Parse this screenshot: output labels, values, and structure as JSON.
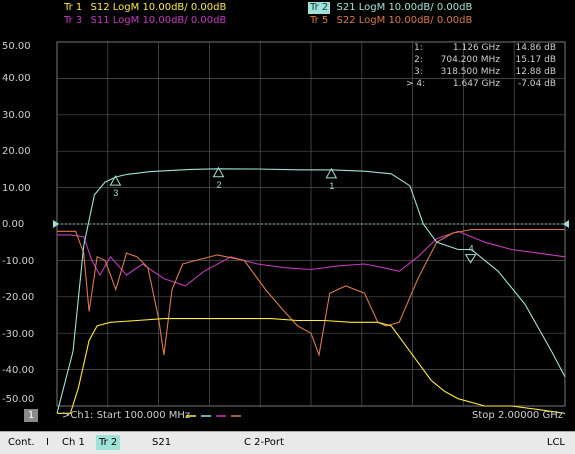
{
  "colors": {
    "s12": "#ffeb3b",
    "s21": "#9fe3d8",
    "s11": "#c73ac0",
    "s22": "#d97b4a",
    "grid": "#555555",
    "text": "#cfcfcf"
  },
  "traces": [
    {
      "tr": "Tr 1",
      "param": "S12",
      "format": "LogM",
      "scale": "10.00dB/",
      "ref": "0.00dB",
      "color": "#ffeb3b",
      "active": false
    },
    {
      "tr": "Tr 2",
      "param": "S21",
      "format": "LogM",
      "scale": "10.00dB/",
      "ref": "0.00dB",
      "color": "#9fe3d8",
      "active": true
    },
    {
      "tr": "Tr 3",
      "param": "S11",
      "format": "LogM",
      "scale": "10.00dB/",
      "ref": "0.00dB",
      "color": "#c73ac0",
      "active": false
    },
    {
      "tr": "Tr 5",
      "param": "S22",
      "format": "LogM",
      "scale": "10.00dB/",
      "ref": "0.00dB",
      "color": "#d97b4a",
      "active": false
    }
  ],
  "markers": [
    {
      "idx": "1:",
      "freq": "1.126 GHz",
      "value": "14.86 dB"
    },
    {
      "idx": "2:",
      "freq": "704.200 MHz",
      "value": "15.17 dB"
    },
    {
      "idx": "3:",
      "freq": "318.500 MHz",
      "value": "12.88 dB"
    },
    {
      "idx": "> 4:",
      "freq": "1.647 GHz",
      "value": "-7.04 dB"
    }
  ],
  "plot": {
    "y_ticks": [
      "50.00",
      "40.00",
      "30.00",
      "20.00",
      "10.00",
      "0.00",
      "-10.00",
      "-20.00",
      "-30.00",
      "-40.00",
      "-50.00"
    ],
    "start_label": ">Ch1:  Start  100.000 MHz",
    "stop_label": "Stop  2.00000 GHz",
    "channel_num": "1"
  },
  "chart_data": {
    "type": "line",
    "xlabel": "",
    "ylabel": "",
    "x_unit": "GHz",
    "xlim": [
      0.1,
      2.0
    ],
    "ylim": [
      -50,
      50
    ],
    "grid": true,
    "series": [
      {
        "name": "S21",
        "x": [
          0.1,
          0.16,
          0.2,
          0.24,
          0.28,
          0.32,
          0.36,
          0.45,
          0.6,
          0.7,
          0.85,
          1.0,
          1.13,
          1.25,
          1.35,
          1.42,
          1.47,
          1.52,
          1.6,
          1.65,
          1.75,
          1.85,
          1.95,
          2.0
        ],
        "y": [
          -52,
          -35,
          -6,
          8,
          11.5,
          12.9,
          13.6,
          14.4,
          15.0,
          15.17,
          15.1,
          14.9,
          14.86,
          14.5,
          13.8,
          10.5,
          0,
          -5,
          -7,
          -7.04,
          -13,
          -22,
          -35,
          -42
        ]
      },
      {
        "name": "S12",
        "x": [
          0.1,
          0.15,
          0.18,
          0.22,
          0.25,
          0.3,
          0.4,
          0.5,
          0.6,
          0.7,
          0.8,
          0.9,
          1.0,
          1.1,
          1.2,
          1.3,
          1.35,
          1.4,
          1.45,
          1.5,
          1.55,
          1.6,
          1.7,
          1.8,
          1.9,
          2.0
        ],
        "y": [
          -52,
          -52,
          -45,
          -32,
          -28,
          -27,
          -26.5,
          -26,
          -26,
          -26,
          -26,
          -26,
          -26.5,
          -26.5,
          -27,
          -27,
          -28,
          -33,
          -38,
          -43,
          -46,
          -48,
          -50,
          -50,
          -51,
          -52
        ]
      },
      {
        "name": "S11",
        "x": [
          0.1,
          0.15,
          0.2,
          0.23,
          0.26,
          0.3,
          0.36,
          0.42,
          0.5,
          0.58,
          0.65,
          0.75,
          0.85,
          0.95,
          1.05,
          1.15,
          1.25,
          1.32,
          1.38,
          1.45,
          1.52,
          1.6,
          1.7,
          1.8,
          1.9,
          2.0
        ],
        "y": [
          -3,
          -3,
          -3.5,
          -10,
          -14,
          -9,
          -14,
          -11,
          -15,
          -17,
          -13,
          -9,
          -11,
          -12,
          -12.5,
          -11.5,
          -11,
          -12,
          -13,
          -9,
          -4,
          -2,
          -5,
          -7,
          -8,
          -9
        ]
      },
      {
        "name": "S22",
        "x": [
          0.1,
          0.17,
          0.2,
          0.22,
          0.25,
          0.28,
          0.32,
          0.36,
          0.4,
          0.44,
          0.48,
          0.5,
          0.53,
          0.57,
          0.62,
          0.7,
          0.8,
          0.88,
          0.95,
          1.0,
          1.05,
          1.08,
          1.12,
          1.18,
          1.25,
          1.3,
          1.33,
          1.38,
          1.45,
          1.52,
          1.58,
          1.65,
          1.75,
          1.85,
          2.0
        ],
        "y": [
          -2,
          -2,
          -8,
          -24,
          -9,
          -10,
          -18,
          -8,
          -9,
          -12,
          -26,
          -36,
          -18,
          -11,
          -10,
          -8.5,
          -10,
          -18,
          -24,
          -28,
          -30,
          -36,
          -19,
          -17,
          -19,
          -27,
          -28,
          -27,
          -15,
          -5,
          -2.5,
          -1.5,
          -1.5,
          -1.5,
          -1.5
        ]
      }
    ],
    "markers": [
      {
        "id": "1",
        "series": "S21",
        "x": 1.126,
        "y": 14.86
      },
      {
        "id": "2",
        "series": "S21",
        "x": 0.7042,
        "y": 15.17
      },
      {
        "id": "3",
        "series": "S21",
        "x": 0.3185,
        "y": 12.88
      },
      {
        "id": "4",
        "series": "S21",
        "x": 1.647,
        "y": -7.04
      }
    ]
  },
  "status": {
    "mode": "Cont.",
    "sep": "I",
    "ch": "Ch 1",
    "tr": "Tr 2",
    "param": "S21",
    "cal": "C  2-Port",
    "lcl": "LCL"
  }
}
